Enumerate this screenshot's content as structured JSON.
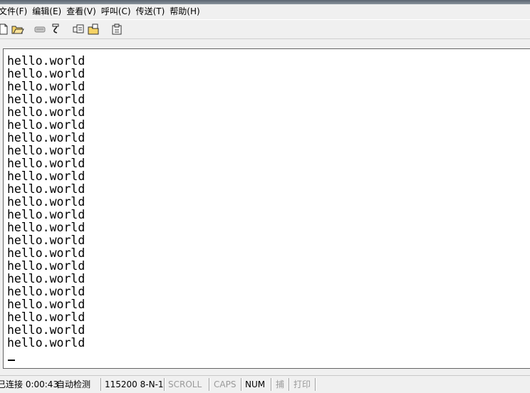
{
  "menu": [
    {
      "label": "文件(F)"
    },
    {
      "label": "编辑(E)"
    },
    {
      "label": "查看(V)"
    },
    {
      "label": "呼叫(C)"
    },
    {
      "label": "传送(T)"
    },
    {
      "label": "帮助(H)"
    }
  ],
  "toolbar": {
    "icons": [
      "new-icon",
      "open-icon",
      "connect-icon",
      "disconnect-icon",
      "send-icon",
      "receive-icon",
      "properties-icon"
    ]
  },
  "terminal": {
    "lines": [
      "hello.world",
      "hello.world",
      "hello.world",
      "hello.world",
      "hello.world",
      "hello.world",
      "hello.world",
      "hello.world",
      "hello.world",
      "hello.world",
      "hello.world",
      "hello.world",
      "hello.world",
      "hello.world",
      "hello.world",
      "hello.world",
      "hello.world",
      "hello.world",
      "hello.world",
      "hello.world",
      "hello.world",
      "hello.world",
      "hello.world"
    ]
  },
  "status": {
    "connection": "已连接 0:00:43",
    "detect": "自动检测",
    "port_settings": "115200 8-N-1",
    "scroll": "SCROLL",
    "caps": "CAPS",
    "num": "NUM",
    "capture": "捕",
    "print": "打印"
  },
  "colors": {
    "background": "#f0f0f0",
    "terminal_bg": "#ffffff",
    "dim_text": "#9a9a9a"
  }
}
